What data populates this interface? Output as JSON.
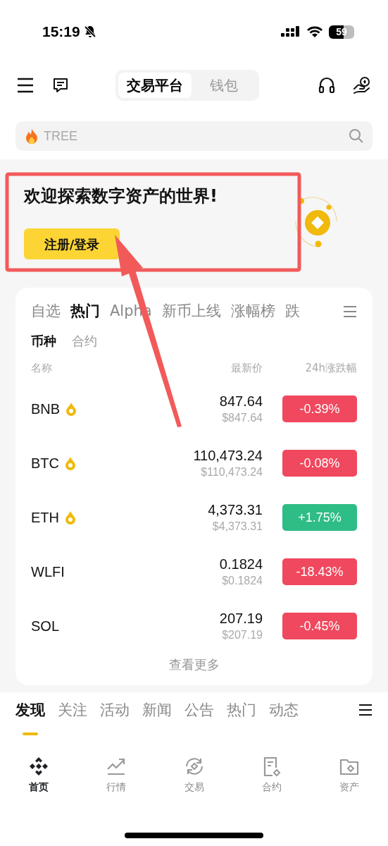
{
  "status_bar": {
    "time": "15:19",
    "battery": "59"
  },
  "header_tabs": [
    {
      "label": "交易平台",
      "selected": true
    },
    {
      "label": "钱包",
      "selected": false
    }
  ],
  "search": {
    "placeholder": "TREE"
  },
  "banner": {
    "title": "欢迎探索数字资产的世界!",
    "button": "注册/登录"
  },
  "market_tabs": [
    {
      "label": "自选",
      "selected": false
    },
    {
      "label": "热门",
      "selected": true
    },
    {
      "label": "Alpha",
      "selected": false
    },
    {
      "label": "新币上线",
      "selected": false
    },
    {
      "label": "涨幅榜",
      "selected": false
    },
    {
      "label": "跌",
      "selected": false
    }
  ],
  "sub_tabs": [
    {
      "label": "币种",
      "selected": true
    },
    {
      "label": "合约",
      "selected": false
    }
  ],
  "columns": [
    "名称",
    "最新价",
    "24h涨跌幅"
  ],
  "rows": [
    {
      "symbol": "BNB",
      "hot": true,
      "price": "847.64",
      "usd": "$847.64",
      "change": "-0.39%",
      "color": "#f0485e"
    },
    {
      "symbol": "BTC",
      "hot": true,
      "price": "110,473.24",
      "usd": "$110,473.24",
      "change": "-0.08%",
      "color": "#f0485e"
    },
    {
      "symbol": "ETH",
      "hot": true,
      "price": "4,373.31",
      "usd": "$4,373.31",
      "change": "+1.75%",
      "color": "#2ebd85"
    },
    {
      "symbol": "WLFI",
      "hot": false,
      "price": "0.1824",
      "usd": "$0.1824",
      "change": "-18.43%",
      "color": "#f0485e"
    },
    {
      "symbol": "SOL",
      "hot": false,
      "price": "207.19",
      "usd": "$207.19",
      "change": "-0.45%",
      "color": "#f0485e"
    }
  ],
  "see_more": "查看更多",
  "feed_tabs": [
    {
      "label": "发现",
      "selected": true
    },
    {
      "label": "关注",
      "selected": false
    },
    {
      "label": "活动",
      "selected": false
    },
    {
      "label": "新闻",
      "selected": false
    },
    {
      "label": "公告",
      "selected": false
    },
    {
      "label": "热门",
      "selected": false
    },
    {
      "label": "动态",
      "selected": false
    }
  ],
  "bottom_nav": [
    {
      "label": "首页",
      "selected": true
    },
    {
      "label": "行情",
      "selected": false
    },
    {
      "label": "交易",
      "selected": false
    },
    {
      "label": "合约",
      "selected": false
    },
    {
      "label": "资产",
      "selected": false
    }
  ]
}
